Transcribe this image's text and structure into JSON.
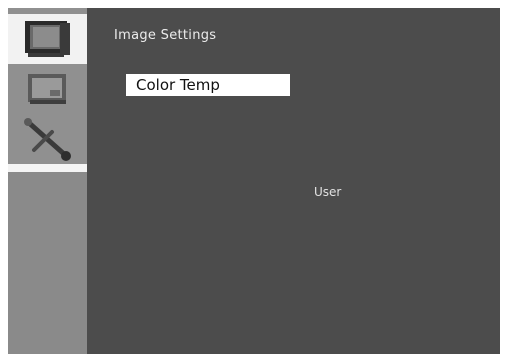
{
  "menu": {
    "title": "Image Settings",
    "selected_item": "Color Temp",
    "selected_value": "User"
  },
  "sidebar": {
    "icons": [
      "monitor-icon",
      "tv-panel-icon",
      "tools-icon"
    ],
    "selected_index": 0
  }
}
